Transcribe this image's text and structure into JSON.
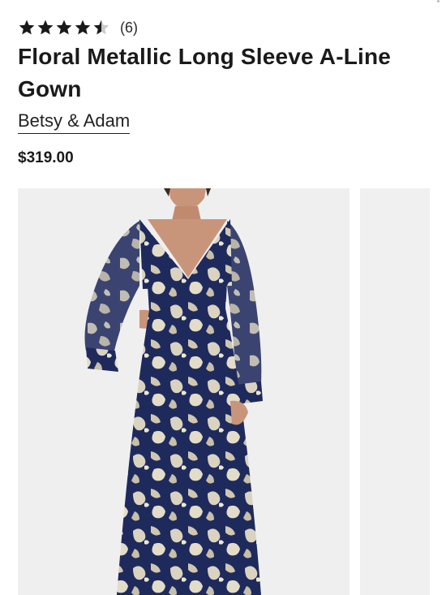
{
  "product": {
    "rating": {
      "value": 4.5,
      "max": 5,
      "count_label": "(6)",
      "star_color": "#1a1a1a",
      "empty_star_color": "#c9c9c9"
    },
    "title": "Floral Metallic Long Sleeve A-Line Gown",
    "brand": "Betsy & Adam",
    "price": "$319.00"
  },
  "gallery": {
    "current_image": "woman-in-navy-floral-metallic-gown",
    "colors": {
      "background": "#efefef",
      "dress_navy": "#1f2a5c",
      "print_metallic": "#d9d3c0",
      "skin": "#c9957a",
      "hair": "#3a2a22"
    }
  }
}
